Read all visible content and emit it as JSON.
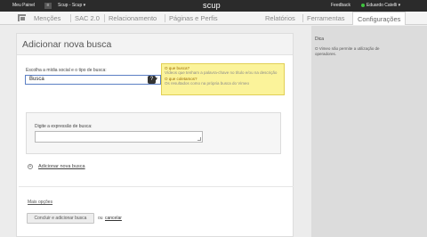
{
  "topbar": {
    "meu_painel": "Meu Painel",
    "menu_glyph": "≡",
    "account": "Scup - Scup ▾",
    "logo": "scup",
    "feedback": "Feedback",
    "user": "Eduardo Catelli ▾",
    "user_status_color": "#3ec43e"
  },
  "nav": {
    "tabs": [
      {
        "label": "Menções"
      },
      {
        "label": "SAC 2.0"
      },
      {
        "label": "Relacionamento"
      },
      {
        "label": "Páginas e Perfis"
      },
      {
        "label": "Relatórios"
      },
      {
        "label": "Ferramentas"
      },
      {
        "label": "Configurações"
      }
    ],
    "active_tab": "Configurações"
  },
  "page": {
    "title": "Adicionar nova busca"
  },
  "form": {
    "select_label": "Escolha a mídia social e o tipo de busca:",
    "select_value": "Busca",
    "help_icon_glyph": "?",
    "tip": {
      "q1": "O que busca?",
      "a1": "Vídeos que tenham a palavra-chave no título e/ou na descrição",
      "q2": "O que coletamos?",
      "a2": "Os resultados como na própria busca do Vimeo"
    },
    "expression_label": "Digite a expressão de busca:",
    "expression_value": "",
    "add_glyph": "+",
    "add_link": "Adicionar nova busca",
    "more_options": "Mais opções",
    "submit_button": "Concluir e adicionar busca",
    "or_text": "ou",
    "cancel_link": "cancelar"
  },
  "sidebar": {
    "title": "Dica",
    "text": "O Vimeo não permite a utilização de operadores."
  }
}
